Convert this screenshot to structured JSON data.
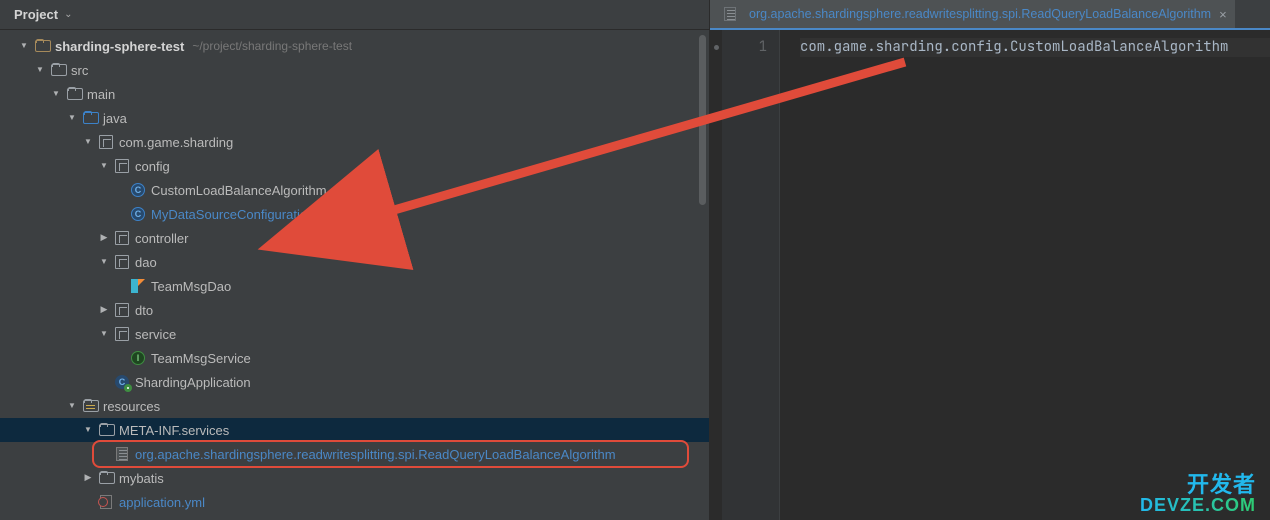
{
  "panel_title": "Project",
  "project_path_hint": "~/project/sharding-sphere-test",
  "tree": [
    {
      "depth": 0,
      "arrow": "open",
      "icon": "root-folder",
      "label": "sharding-sphere-test",
      "bold": true,
      "path_hint": true
    },
    {
      "depth": 1,
      "arrow": "open",
      "icon": "folder",
      "label": "src"
    },
    {
      "depth": 2,
      "arrow": "open",
      "icon": "folder",
      "label": "main"
    },
    {
      "depth": 3,
      "arrow": "open",
      "icon": "folder-blue",
      "label": "java"
    },
    {
      "depth": 4,
      "arrow": "open",
      "icon": "pkg",
      "label": "com.game.sharding"
    },
    {
      "depth": 5,
      "arrow": "open",
      "icon": "pkg",
      "label": "config"
    },
    {
      "depth": 6,
      "arrow": "none",
      "icon": "class",
      "label": "CustomLoadBalanceAlgorithm"
    },
    {
      "depth": 6,
      "arrow": "none",
      "icon": "class",
      "label": "MyDataSourceConfiguration",
      "blue": true
    },
    {
      "depth": 5,
      "arrow": "closed",
      "icon": "pkg",
      "label": "controller"
    },
    {
      "depth": 5,
      "arrow": "open",
      "icon": "pkg",
      "label": "dao"
    },
    {
      "depth": 6,
      "arrow": "none",
      "icon": "kt",
      "label": "TeamMsgDao"
    },
    {
      "depth": 5,
      "arrow": "closed",
      "icon": "pkg",
      "label": "dto"
    },
    {
      "depth": 5,
      "arrow": "open",
      "icon": "pkg",
      "label": "service"
    },
    {
      "depth": 6,
      "arrow": "none",
      "icon": "int",
      "label": "TeamMsgService"
    },
    {
      "depth": 5,
      "arrow": "none",
      "icon": "boot",
      "label": "ShardingApplication"
    },
    {
      "depth": 3,
      "arrow": "open",
      "icon": "folder-res",
      "label": "resources"
    },
    {
      "depth": 4,
      "arrow": "open",
      "icon": "folder",
      "label": "META-INF.services",
      "row_hl": true
    },
    {
      "depth": 5,
      "arrow": "none",
      "icon": "file",
      "label": "org.apache.shardingsphere.readwritesplitting.spi.ReadQueryLoadBalanceAlgorithm",
      "blue": true,
      "redbox": true
    },
    {
      "depth": 4,
      "arrow": "closed",
      "icon": "folder",
      "label": "mybatis"
    },
    {
      "depth": 4,
      "arrow": "none",
      "icon": "yml",
      "label": "application.yml",
      "blue": true
    }
  ],
  "editor": {
    "tab_label": "org.apache.shardingsphere.readwritesplitting.spi.ReadQueryLoadBalanceAlgorithm",
    "line_number": "1",
    "line_text": "com.game.sharding.config.CustomLoadBalanceAlgorithm"
  },
  "watermark": {
    "l1": "开发者",
    "l2": "DEVZE.COM"
  }
}
